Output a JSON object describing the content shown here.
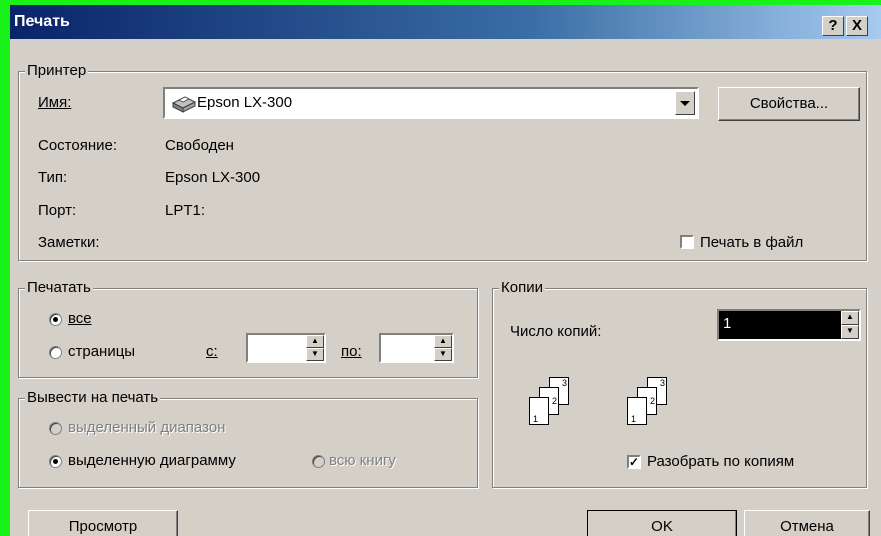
{
  "dialog": {
    "title": "Печать",
    "help_glyph": "?",
    "close_glyph": "X"
  },
  "printer": {
    "group_title": "Принтер",
    "name_label": "Имя:",
    "name_value": "Epson LX-300",
    "properties_button": "Свойства...",
    "status_label": "Состояние:",
    "status_value": "Свободен",
    "type_label": "Тип:",
    "type_value": "Epson LX-300",
    "port_label": "Порт:",
    "port_value": "LPT1:",
    "notes_label": "Заметки:",
    "print_to_file_label": "Печать в файл",
    "print_to_file_checked": false
  },
  "print_range": {
    "group_title": "Печатать",
    "all_label": "все",
    "pages_label": "страницы",
    "from_label": "с:",
    "to_label": "по:",
    "from_value": "",
    "to_value": "",
    "selected": "all"
  },
  "print_what": {
    "group_title": "Вывести на печать",
    "selection_label": "выделенный диапазон",
    "chart_label": "выделенную диаграмму",
    "workbook_label": "всю книгу",
    "selected": "chart"
  },
  "copies": {
    "group_title": "Копии",
    "count_label": "Число копий:",
    "count_value": "1",
    "collate_label": "Разобрать по копиям",
    "collate_checked": true,
    "page_numbers": [
      "1",
      "2",
      "3"
    ]
  },
  "footer": {
    "preview_button": "Просмотр",
    "ok_button": "OK",
    "cancel_button": "Отмена"
  }
}
